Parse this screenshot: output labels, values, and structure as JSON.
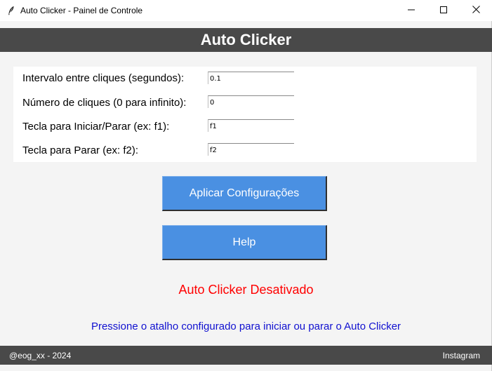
{
  "window": {
    "title": "Auto Clicker - Painel de Controle",
    "app_icon": "feather-icon",
    "controls": [
      "minimize-icon",
      "maximize-icon",
      "close-icon"
    ]
  },
  "header": {
    "title": "Auto Clicker"
  },
  "settings": {
    "interval": {
      "label": "Intervalo entre cliques (segundos):",
      "value": "0.1"
    },
    "clicks": {
      "label": "Número de cliques (0 para infinito):",
      "value": "0"
    },
    "start_key": {
      "label": "Tecla para Iniciar/Parar (ex: f1):",
      "value": "f1"
    },
    "stop_key": {
      "label": "Tecla para Parar (ex: f2):",
      "value": "f2"
    }
  },
  "buttons": {
    "apply_label": "Aplicar Configurações",
    "help_label": "Help"
  },
  "status": {
    "text": "Auto Clicker Desativado",
    "color": "#ff0000"
  },
  "hint": {
    "text": "Pressione o atalho configurado para iniciar ou parar o Auto Clicker",
    "color": "#1010d0"
  },
  "footer": {
    "left": "@eog_xx - 2024",
    "right": "Instagram"
  },
  "colors": {
    "header_bg": "#494949",
    "button_bg": "#4a90e2",
    "background": "#f4f4f4",
    "panel_bg": "#ffffff"
  }
}
